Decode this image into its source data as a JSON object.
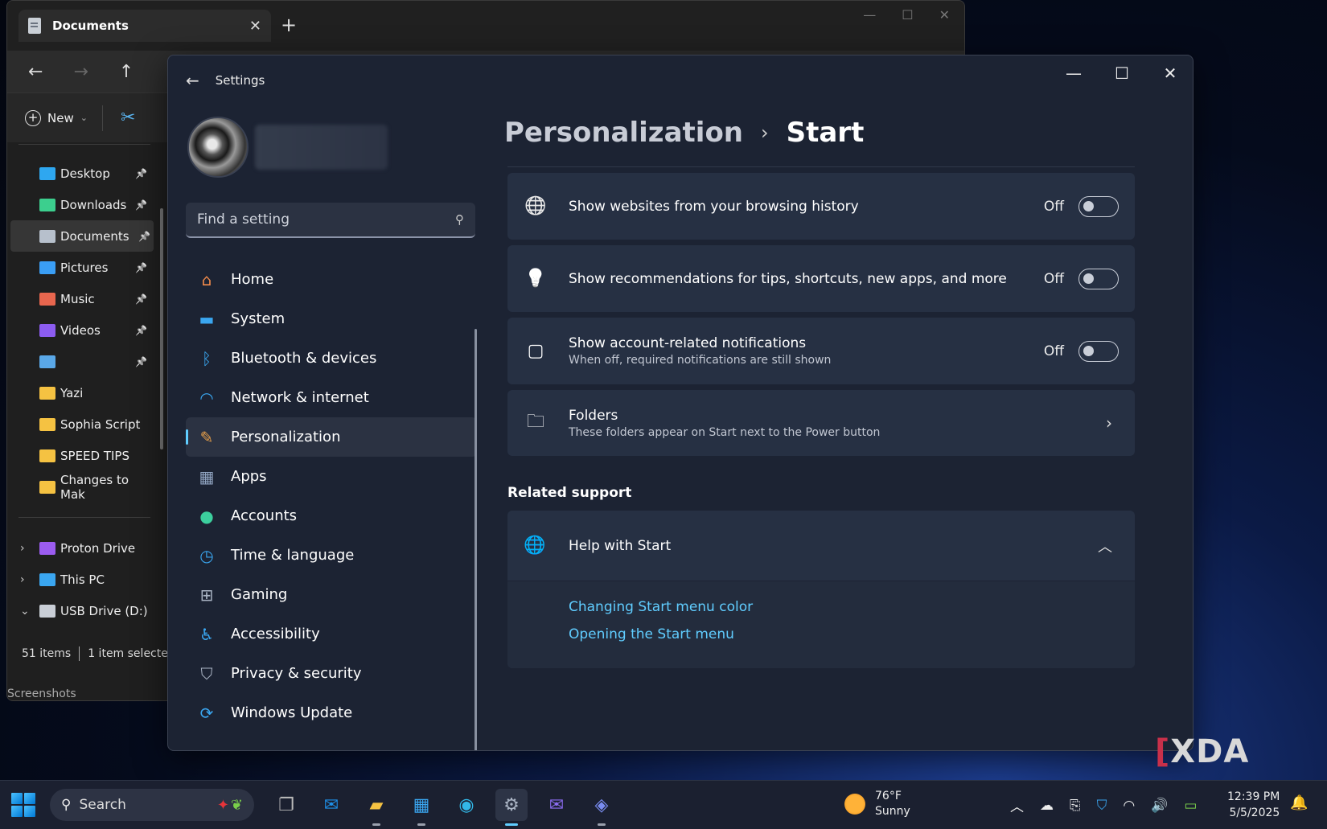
{
  "explorer": {
    "tab_title": "Documents",
    "new_label": "New",
    "quick_access": [
      {
        "label": "Desktop",
        "color": "#2ea7f0",
        "pinned": true
      },
      {
        "label": "Downloads",
        "color": "#3ccf8e",
        "pinned": true
      },
      {
        "label": "Documents",
        "color": "#b7c0cc",
        "pinned": true
      },
      {
        "label": "Pictures",
        "color": "#3a9ef5",
        "pinned": true
      },
      {
        "label": "Music",
        "color": "#e8664e",
        "pinned": true
      },
      {
        "label": "Videos",
        "color": "#8c5cf0",
        "pinned": true
      },
      {
        "label": "",
        "color": "#5aa8e8",
        "pinned": true
      },
      {
        "label": "Yazi",
        "color": "#f5c242",
        "pinned": false
      },
      {
        "label": "Sophia Script",
        "color": "#f5c242",
        "pinned": false
      },
      {
        "label": "SPEED TIPS",
        "color": "#f5c242",
        "pinned": false
      },
      {
        "label": "Changes to Mak",
        "color": "#f5c242",
        "pinned": false
      }
    ],
    "drives": [
      {
        "label": "Proton Drive",
        "color": "#9b5cf0",
        "expander": "›"
      },
      {
        "label": "This PC",
        "color": "#3aa6f0",
        "expander": "›"
      },
      {
        "label": "USB Drive (D:)",
        "color": "#c9ced6",
        "expander": "⌄"
      }
    ],
    "status_items": "51 items",
    "status_selected": "1 item selecte",
    "peek_text": "Screenshots"
  },
  "settings": {
    "window_title": "Settings",
    "search_placeholder": "Find a setting",
    "nav": [
      {
        "label": "Home",
        "icon": "home-icon",
        "glyph": "⌂",
        "color": "#f08a4b"
      },
      {
        "label": "System",
        "icon": "system-icon",
        "glyph": "▬",
        "color": "#3aa6f0"
      },
      {
        "label": "Bluetooth & devices",
        "icon": "bluetooth-icon",
        "glyph": "ᛒ",
        "color": "#3aa6f0"
      },
      {
        "label": "Network & internet",
        "icon": "wifi-icon",
        "glyph": "◠",
        "color": "#3aa6f0"
      },
      {
        "label": "Personalization",
        "icon": "brush-icon",
        "glyph": "✎",
        "color": "#e8a04a"
      },
      {
        "label": "Apps",
        "icon": "apps-icon",
        "glyph": "▦",
        "color": "#8fa3c0"
      },
      {
        "label": "Accounts",
        "icon": "accounts-icon",
        "glyph": "●",
        "color": "#3ccf9e"
      },
      {
        "label": "Time & language",
        "icon": "clock-globe-icon",
        "glyph": "◷",
        "color": "#3aa6f0"
      },
      {
        "label": "Gaming",
        "icon": "gamepad-icon",
        "glyph": "⊞",
        "color": "#aab4c4"
      },
      {
        "label": "Accessibility",
        "icon": "accessibility-icon",
        "glyph": "♿",
        "color": "#3aa6f0"
      },
      {
        "label": "Privacy & security",
        "icon": "shield-icon",
        "glyph": "⛉",
        "color": "#aab4c4"
      },
      {
        "label": "Windows Update",
        "icon": "update-icon",
        "glyph": "⟳",
        "color": "#3aa6f0"
      }
    ],
    "active_nav_index": 4,
    "breadcrumb": {
      "parent": "Personalization",
      "separator": "›",
      "current": "Start"
    },
    "cards": [
      {
        "title": "Show websites from your browsing history",
        "subtitle": "",
        "icon": "globe-icon",
        "glyph": "🌐",
        "state": "Off",
        "control": "toggle"
      },
      {
        "title": "Show recommendations for tips, shortcuts, new apps, and more",
        "subtitle": "",
        "icon": "lightbulb-icon",
        "glyph": "💡",
        "state": "Off",
        "control": "toggle"
      },
      {
        "title": "Show account-related notifications",
        "subtitle": "When off, required notifications are still shown",
        "icon": "notification-icon",
        "glyph": "▢",
        "state": "Off",
        "control": "toggle"
      },
      {
        "title": "Folders",
        "subtitle": "These folders appear on Start next to the Power button",
        "icon": "folder-icon",
        "glyph": "🗀",
        "state": "",
        "control": "chevron"
      }
    ],
    "related_support": {
      "heading": "Related support",
      "help_title": "Help with Start",
      "links": [
        "Changing Start menu color",
        "Opening the Start menu"
      ]
    }
  },
  "watermark": {
    "bracket": "[",
    "text": "XDA"
  },
  "taskbar": {
    "search_label": "Search",
    "weather_temp": "76°F",
    "weather_desc": "Sunny",
    "time": "12:39 PM",
    "date": "5/5/2025"
  }
}
